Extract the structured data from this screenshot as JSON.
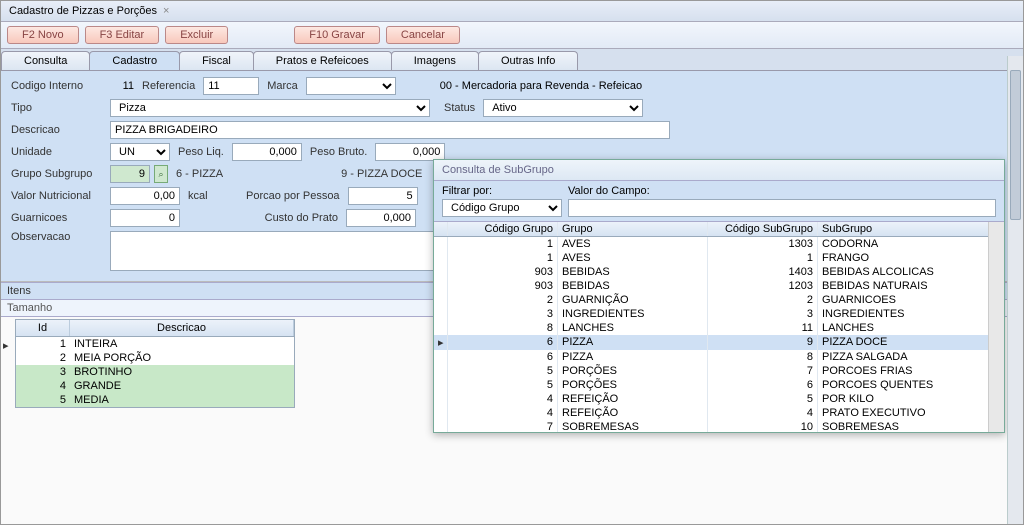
{
  "window": {
    "title": "Cadastro de Pizzas e Porções"
  },
  "toolbar": {
    "novo": "F2 Novo",
    "editar": "F3 Editar",
    "excluir": "Excluir",
    "gravar": "F10 Gravar",
    "cancelar": "Cancelar"
  },
  "tabs": {
    "consulta": "Consulta",
    "cadastro": "Cadastro",
    "fiscal": "Fiscal",
    "pratos": "Pratos e Refeicoes",
    "imagens": "Imagens",
    "outras": "Outras Info"
  },
  "form": {
    "codigo_lbl": "Codigo Interno",
    "codigo_val": "11",
    "ref_lbl": "Referencia",
    "ref_val": "11",
    "marca_lbl": "Marca",
    "marca_val": "",
    "merc": "00 - Mercadoria para Revenda - Refeicao",
    "tipo_lbl": "Tipo",
    "tipo_val": "Pizza",
    "status_lbl": "Status",
    "status_val": "Ativo",
    "descr_lbl": "Descricao",
    "descr_val": "PIZZA BRIGADEIRO",
    "unid_lbl": "Unidade",
    "unid_val": "UN",
    "pesoliq_lbl": "Peso Liq.",
    "pesoliq_val": "0,000",
    "pesobruto_lbl": "Peso Bruto.",
    "pesobruto_val": "0,000",
    "grupo_lbl": "Grupo Subgrupo",
    "grupo_val": "9",
    "grupo_desc": "6 - PIZZA",
    "subgrupo_desc": "9 - PIZZA DOCE",
    "valnut_lbl": "Valor Nutricional",
    "valnut_val": "0,00",
    "kcal": "kcal",
    "porcao_lbl": "Porcao por Pessoa",
    "porcao_val": "5",
    "guarn_lbl": "Guarnicoes",
    "guarn_val": "0",
    "custo_lbl": "Custo do Prato",
    "custo_val": "0,000",
    "obs_lbl": "Observacao",
    "obs_val": ""
  },
  "itens": {
    "hdr": "Itens",
    "tam": "Tamanho",
    "col_id": "Id",
    "col_desc": "Descricao",
    "rows": [
      {
        "id": "1",
        "desc": "INTEIRA",
        "sel": false
      },
      {
        "id": "2",
        "desc": "MEIA PORÇÃO",
        "sel": false
      },
      {
        "id": "3",
        "desc": "BROTINHO",
        "sel": true
      },
      {
        "id": "4",
        "desc": "GRANDE",
        "sel": true
      },
      {
        "id": "5",
        "desc": "MEDIA",
        "sel": true
      }
    ]
  },
  "popup": {
    "title": "Consulta de SubGrupo",
    "filtrar_lbl": "Filtrar por:",
    "filtrar_val": "Código Grupo",
    "valor_lbl": "Valor do Campo:",
    "valor_val": "",
    "col1": "Código Grupo",
    "col2": "Grupo",
    "col3": "Código SubGrupo",
    "col4": "SubGrupo",
    "rows": [
      {
        "cg": "1",
        "g": "AVES",
        "cs": "1303",
        "s": "CODORNA",
        "sel": false
      },
      {
        "cg": "1",
        "g": "AVES",
        "cs": "1",
        "s": "FRANGO",
        "sel": false
      },
      {
        "cg": "903",
        "g": "BEBIDAS",
        "cs": "1403",
        "s": "BEBIDAS ALCOLICAS",
        "sel": false
      },
      {
        "cg": "903",
        "g": "BEBIDAS",
        "cs": "1203",
        "s": "BEBIDAS NATURAIS",
        "sel": false
      },
      {
        "cg": "2",
        "g": "GUARNIÇÃO",
        "cs": "2",
        "s": "GUARNICOES",
        "sel": false
      },
      {
        "cg": "3",
        "g": "INGREDIENTES",
        "cs": "3",
        "s": "INGREDIENTES",
        "sel": false
      },
      {
        "cg": "8",
        "g": "LANCHES",
        "cs": "11",
        "s": "LANCHES",
        "sel": false
      },
      {
        "cg": "6",
        "g": "PIZZA",
        "cs": "9",
        "s": "PIZZA DOCE",
        "sel": true
      },
      {
        "cg": "6",
        "g": "PIZZA",
        "cs": "8",
        "s": "PIZZA SALGADA",
        "sel": false
      },
      {
        "cg": "5",
        "g": "PORÇÕES",
        "cs": "7",
        "s": "PORCOES FRIAS",
        "sel": false
      },
      {
        "cg": "5",
        "g": "PORÇÕES",
        "cs": "6",
        "s": "PORCOES QUENTES",
        "sel": false
      },
      {
        "cg": "4",
        "g": "REFEIÇÃO",
        "cs": "5",
        "s": "POR KILO",
        "sel": false
      },
      {
        "cg": "4",
        "g": "REFEIÇÃO",
        "cs": "4",
        "s": "PRATO EXECUTIVO",
        "sel": false
      },
      {
        "cg": "7",
        "g": "SOBREMESAS",
        "cs": "10",
        "s": "SOBREMESAS",
        "sel": false
      }
    ]
  }
}
